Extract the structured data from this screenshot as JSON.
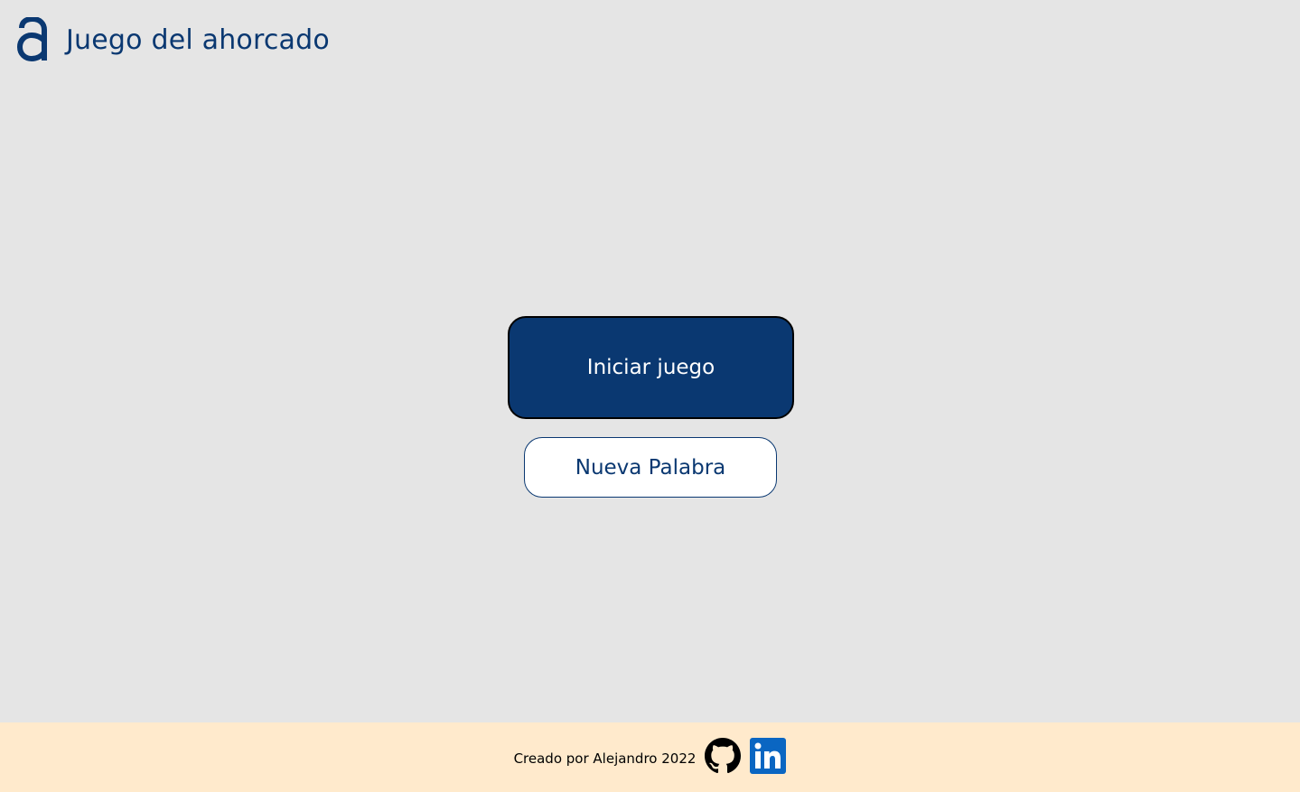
{
  "app": {
    "logo_icon": "alura-a-logo-icon",
    "title": "Juego del ahorcado"
  },
  "main": {
    "start_button_label": "Iniciar juego",
    "new_word_button_label": "Nueva Palabra"
  },
  "footer": {
    "credit_text": "Creado por Alejandro 2022",
    "links": [
      {
        "icon": "github-icon"
      },
      {
        "icon": "linkedin-icon"
      }
    ]
  },
  "colors": {
    "primary": "#0a3871",
    "background": "#e5e5e5",
    "footer_background": "#ffeacc",
    "linkedin": "#0a66c2"
  }
}
